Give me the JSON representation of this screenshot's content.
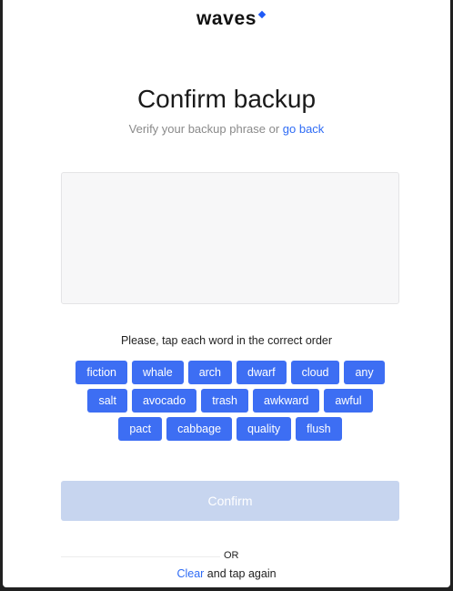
{
  "brand": {
    "name": "waves",
    "accent_color": "#1f5af6"
  },
  "page": {
    "title": "Confirm backup",
    "subtitle_text": "Verify your backup phrase or ",
    "subtitle_link": "go back"
  },
  "instruction": "Please, tap each word in the correct order",
  "words": {
    "row1": [
      "fiction",
      "whale",
      "arch",
      "dwarf",
      "cloud",
      "any"
    ],
    "row2": [
      "salt",
      "avocado",
      "trash",
      "awkward",
      "awful"
    ],
    "row3": [
      "pact",
      "cabbage",
      "quality",
      "flush"
    ]
  },
  "confirm_button": {
    "label": "Confirm",
    "disabled": true
  },
  "footer": {
    "or_text": "OR",
    "clear_link": "Clear",
    "clear_suffix": " and tap again"
  }
}
